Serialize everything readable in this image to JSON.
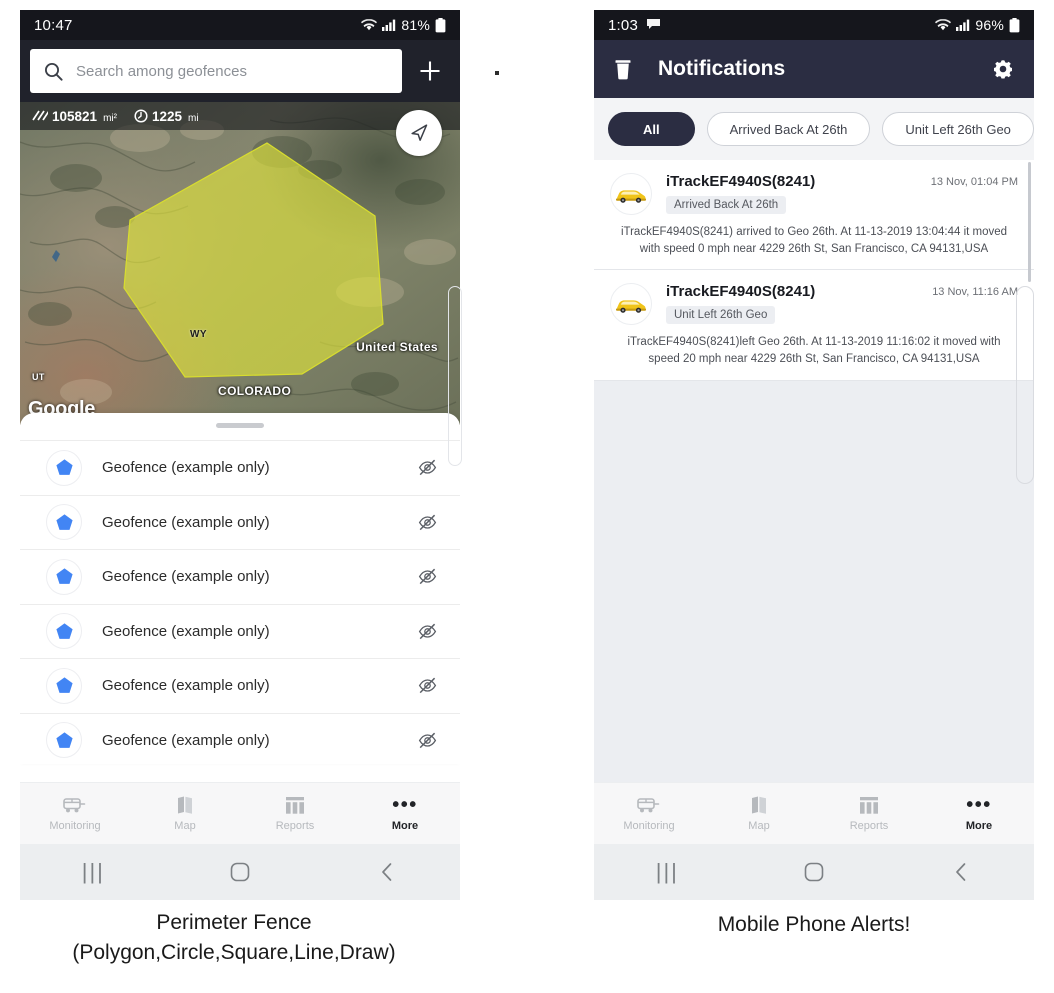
{
  "left_phone": {
    "status_bar": {
      "time": "10:47",
      "battery": "81%",
      "wifi_icon": "wifi-icon",
      "signal_icon": "signal-icon",
      "battery_icon": "battery-icon"
    },
    "search": {
      "placeholder": "Search among geofences",
      "icon": "search-icon",
      "add_label": "+"
    },
    "map": {
      "area_value": "105821",
      "area_unit": "mi²",
      "area_icon": "area-hatch-icon",
      "perimeter_value": "1225",
      "perimeter_unit": "mi",
      "perimeter_icon": "perimeter-clock-icon",
      "locate_icon": "navigation-arrow-icon",
      "provider_logo": "Google",
      "labels": {
        "wy": "WY",
        "ut": "UT",
        "united_states": "United States",
        "colorado": "COLORADO"
      },
      "polygon_color": "#e3e83a"
    },
    "geofences": [
      {
        "name": "Geofence (example only)",
        "icon": "pentagon-icon",
        "visibility_icon": "eye-off-icon"
      },
      {
        "name": "Geofence (example only)",
        "icon": "pentagon-icon",
        "visibility_icon": "eye-off-icon"
      },
      {
        "name": "Geofence (example only)",
        "icon": "pentagon-icon",
        "visibility_icon": "eye-off-icon"
      },
      {
        "name": "Geofence (example only)",
        "icon": "pentagon-icon",
        "visibility_icon": "eye-off-icon"
      },
      {
        "name": "Geofence (example only)",
        "icon": "pentagon-icon",
        "visibility_icon": "eye-off-icon"
      },
      {
        "name": "Geofence (example only)",
        "icon": "pentagon-icon",
        "visibility_icon": "eye-off-icon"
      }
    ],
    "tabs": [
      {
        "label": "Monitoring",
        "icon": "bus-icon",
        "active": false
      },
      {
        "label": "Map",
        "icon": "map-icon",
        "active": false
      },
      {
        "label": "Reports",
        "icon": "reports-icon",
        "active": false
      },
      {
        "label": "More",
        "icon": "more-dots-icon",
        "active": true
      }
    ],
    "nav": {
      "recents_icon": "recents-icon",
      "home_icon": "home-icon",
      "back_icon": "back-icon"
    }
  },
  "right_phone": {
    "status_bar": {
      "time": "1:03",
      "chat_icon": "chat-bubble-icon",
      "battery": "96%",
      "wifi_icon": "wifi-icon",
      "signal_icon": "signal-icon",
      "battery_icon": "battery-icon"
    },
    "app_bar": {
      "title": "Notifications",
      "delete_icon": "trash-icon",
      "settings_icon": "gear-icon",
      "background": "#2b2d42"
    },
    "filter_chips": [
      {
        "label": "All",
        "active": true
      },
      {
        "label": "Arrived Back At 26th",
        "active": false
      },
      {
        "label": "Unit Left 26th Geo",
        "active": false
      }
    ],
    "notifications": [
      {
        "title": "iTrackEF4940S(8241)",
        "badge": "Arrived Back At 26th",
        "time": "13 Nov, 01:04 PM",
        "description": "iTrackEF4940S(8241) arrived to Geo 26th.     At 11-13-2019 13:04:44 it moved with speed 0 mph near 4229 26th St, San Francisco, CA 94131,USA",
        "avatar_icon": "yellow-car-icon"
      },
      {
        "title": "iTrackEF4940S(8241)",
        "badge": "Unit Left 26th Geo",
        "time": "13 Nov, 11:16 AM",
        "description": "iTrackEF4940S(8241)left Geo 26th.     At 11-13-2019 11:16:02 it moved with speed 20 mph near 4229 26th St, San Francisco, CA 94131,USA",
        "avatar_icon": "yellow-car-icon"
      }
    ],
    "tabs": [
      {
        "label": "Monitoring",
        "icon": "bus-icon",
        "active": false
      },
      {
        "label": "Map",
        "icon": "map-icon",
        "active": false
      },
      {
        "label": "Reports",
        "icon": "reports-icon",
        "active": false
      },
      {
        "label": "More",
        "icon": "more-dots-icon",
        "active": true
      }
    ],
    "nav": {
      "recents_icon": "recents-icon",
      "home_icon": "home-icon",
      "back_icon": "back-icon"
    }
  },
  "captions": {
    "left_line1": "Perimeter Fence",
    "left_line2": "(Polygon,Circle,Square,Line,Draw)",
    "right": "Mobile Phone Alerts!"
  }
}
